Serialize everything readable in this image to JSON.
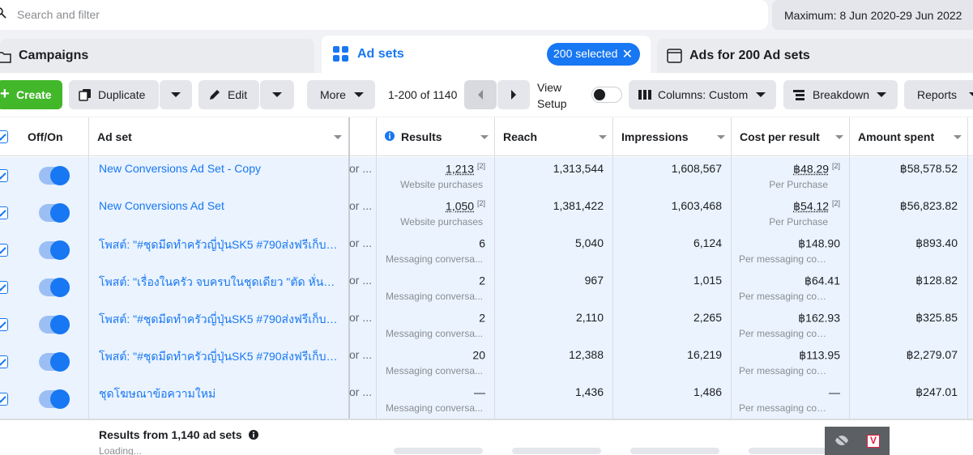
{
  "search": {
    "placeholder": "Search and filter"
  },
  "date_range": "Maximum: 8 Jun 2020-29 Jun 2022",
  "tabs": {
    "campaigns": "Campaigns",
    "adsets": "Ad sets",
    "selected_badge": "200 selected",
    "ads": "Ads for 200 Ad sets"
  },
  "toolbar": {
    "create": "Create",
    "duplicate": "Duplicate",
    "edit": "Edit",
    "more": "More",
    "pager": "1-200 of 1140",
    "view_setup_1": "View",
    "view_setup_2": "Setup",
    "columns": "Columns: Custom",
    "breakdown": "Breakdown",
    "reports": "Reports"
  },
  "columns": {
    "onoff": "Off/On",
    "adset": "Ad set",
    "results": "Results",
    "reach": "Reach",
    "impressions": "Impressions",
    "cost": "Cost per result",
    "amount": "Amount spent"
  },
  "rows": [
    {
      "name": "New Conversions Ad Set - Copy",
      "partial": "or ...",
      "results": "1,213",
      "results_sup": "[2]",
      "results_sub": "Website purchases",
      "reach": "1,313,544",
      "impressions": "1,608,567",
      "cost": "฿48.29",
      "cost_sup": "[2]",
      "cost_sub": "Per Purchase",
      "amount": "฿58,578.52"
    },
    {
      "name": "New Conversions Ad Set",
      "partial": "or ...",
      "results": "1,050",
      "results_sup": "[2]",
      "results_sub": "Website purchases",
      "reach": "1,381,422",
      "impressions": "1,603,468",
      "cost": "฿54.12",
      "cost_sup": "[2]",
      "cost_sub": "Per Purchase",
      "amount": "฿56,823.82"
    },
    {
      "name": "โพสต์: \"#ชุดมีดทำครัวญี่ปุ่นSK5 #790ส่งฟรีเก็บเงิ...",
      "partial": "or ...",
      "results": "6",
      "results_sup": "",
      "results_sub": "Messaging conversa...",
      "reach": "5,040",
      "impressions": "6,124",
      "cost": "฿148.90",
      "cost_sup": "",
      "cost_sub": "Per messaging conv...",
      "amount": "฿893.40"
    },
    {
      "name": "โพสต์: \"เรื่องในครัว จบครบในชุดเดียว \"ตัด หั่น สับ ...",
      "partial": "or ...",
      "results": "2",
      "results_sup": "",
      "results_sub": "Messaging conversa...",
      "reach": "967",
      "impressions": "1,015",
      "cost": "฿64.41",
      "cost_sup": "",
      "cost_sub": "Per messaging conv...",
      "amount": "฿128.82"
    },
    {
      "name": "โพสต์: \"#ชุดมีดทำครัวญี่ปุ่นSK5 #790ส่งฟรีเก็บเงิ...",
      "partial": "or ...",
      "results": "2",
      "results_sup": "",
      "results_sub": "Messaging conversa...",
      "reach": "2,110",
      "impressions": "2,265",
      "cost": "฿162.93",
      "cost_sup": "",
      "cost_sub": "Per messaging conv...",
      "amount": "฿325.85"
    },
    {
      "name": "โพสต์: \"#ชุดมีดทำครัวญี่ปุ่นSK5 #790ส่งฟรีเก็บเงิ...",
      "partial": "or ...",
      "results": "20",
      "results_sup": "",
      "results_sub": "Messaging conversa...",
      "reach": "12,388",
      "impressions": "16,219",
      "cost": "฿113.95",
      "cost_sup": "",
      "cost_sub": "Per messaging conv...",
      "amount": "฿2,279.07"
    },
    {
      "name": "ชุดโฆษณาข้อความใหม่",
      "partial": "or ...",
      "results": "—",
      "results_sup": "",
      "results_sub": "Messaging conversa...",
      "reach": "1,436",
      "impressions": "1,486",
      "cost": "—",
      "cost_sup": "",
      "cost_sub": "Per messaging conv...",
      "amount": "฿247.01"
    }
  ],
  "footer": {
    "summary": "Results from 1,140 ad sets",
    "loading": "Loading..."
  },
  "extension": {
    "label": "V"
  },
  "colors": {
    "accent": "#1877f2",
    "create": "#42b72a",
    "row_highlight": "#eaf3fe"
  }
}
